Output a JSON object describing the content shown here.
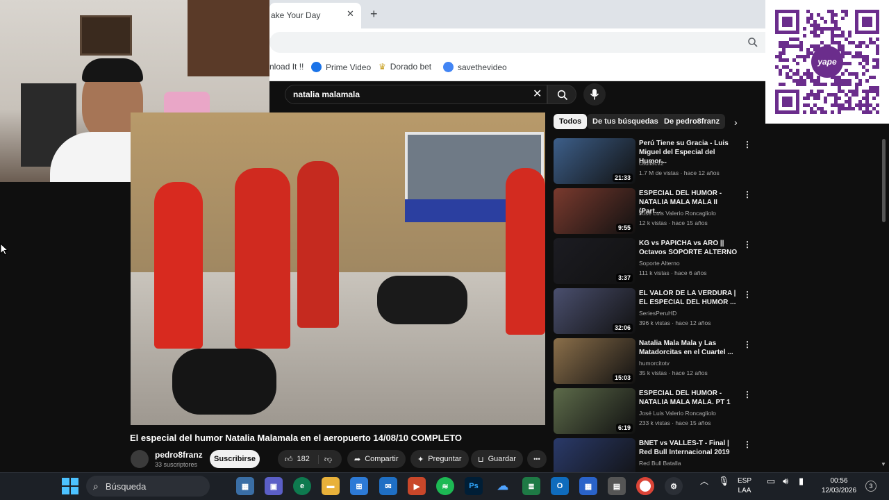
{
  "browser": {
    "tab_title": "ake Your Day",
    "tab_close": "✕",
    "new_tab": "+",
    "bookmarks": [
      {
        "label": "nload It !!",
        "color": "#ffffff"
      },
      {
        "label": "Prime Video",
        "color": "#1a73e8"
      },
      {
        "label": "Dorado bet",
        "color": "#c9a227"
      },
      {
        "label": "savethevideo",
        "color": "#4285f4"
      }
    ],
    "zoom_icon": "magnifier-icon"
  },
  "youtube": {
    "search": {
      "query": "natalia malamala",
      "clear": "✕"
    },
    "video": {
      "title": "El especial del humor Natalia Malamala en el aeropuerto 14/08/10 COMPLETO",
      "channel": "pedro8franz",
      "subscribers": "33 suscriptores",
      "subscribe_label": "Suscribirse",
      "likes": "182",
      "share_label": "Compartir",
      "ask_label": "Preguntar",
      "save_label": "Guardar",
      "more": "•••"
    },
    "chips": [
      "Todos",
      "De tus búsquedas",
      "De pedro8franz"
    ],
    "recommendations": [
      {
        "title": "Perú Tiene su Gracia - Luis Miguel del Especial del Humor...",
        "channel": "cadilacv2",
        "meta": "1.7 M de vistas · hace 12 años",
        "duration": "21:33",
        "color": "#3d5f8a"
      },
      {
        "title": "ESPECIAL DEL HUMOR - NATALIA MALA MALA II (Part...",
        "channel": "José Luis Valerio Roncagliolo",
        "meta": "12 k vistas · hace 15 años",
        "duration": "9:55",
        "color": "#7a3a2e"
      },
      {
        "title": "KG vs PAPICHA vs ARO || Octavos SOPORTE ALTERNO",
        "channel": "Soporte Alterno",
        "meta": "111 k vistas · hace 6 años",
        "duration": "3:37",
        "color": "#1c1c22"
      },
      {
        "title": "EL VALOR DE LA VERDURA | EL ESPECIAL DEL HUMOR ...",
        "channel": "SeriesPeruHD",
        "meta": "396 k vistas · hace 12 años",
        "duration": "32:06",
        "color": "#4a4f6e"
      },
      {
        "title": "Natalia Mala Mala y Las Matadorcitas en el Cuartel ...",
        "channel": "humorcitotv",
        "meta": "35 k vistas · hace 12 años",
        "duration": "15:03",
        "color": "#8b6f4a"
      },
      {
        "title": "ESPECIAL DEL HUMOR - NATALIA MALA MALA. PT 1",
        "channel": "José Luis Valerio Roncagliolo",
        "meta": "233 k vistas · hace 15 años",
        "duration": "6:19",
        "color": "#5d6b4a"
      },
      {
        "title": "BNET vs VALLES-T - Final | Red Bull Internacional 2019",
        "channel": "Red Bull Batalla",
        "meta": "",
        "duration": "",
        "color": "#2a3a6a"
      }
    ]
  },
  "taskbar": {
    "search_label": "Búsqueda",
    "language": "ESP",
    "layout": "LAA",
    "time": "00:56",
    "date": "12/03/2026",
    "notifications": "3"
  },
  "overlay": {
    "qr_brand": "yape"
  }
}
